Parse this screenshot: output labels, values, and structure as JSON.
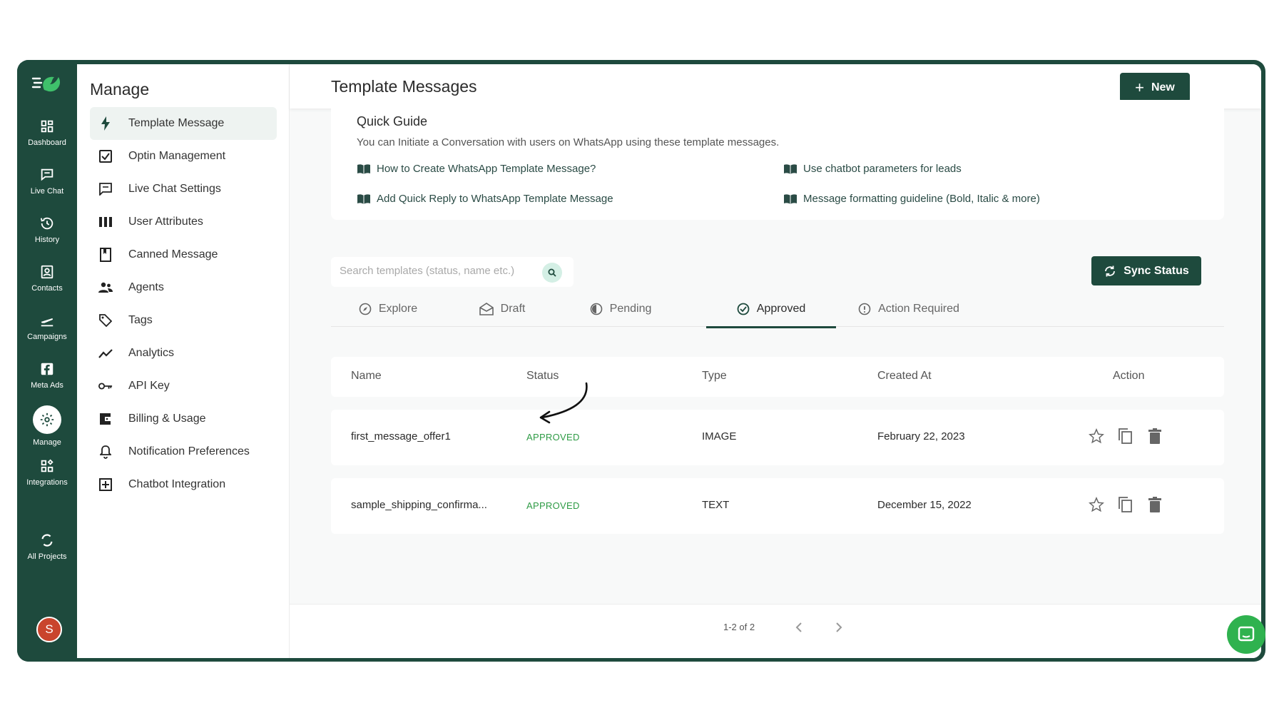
{
  "colors": {
    "brand_dark": "#1e4a3d",
    "approved_green": "#2e9b45",
    "chat_fab": "#2fb24f",
    "avatar": "#c9452d"
  },
  "rail": {
    "items": [
      {
        "label": "Dashboard",
        "icon": "grid-icon"
      },
      {
        "label": "Live Chat",
        "icon": "chat-icon"
      },
      {
        "label": "History",
        "icon": "history-icon"
      },
      {
        "label": "Contacts",
        "icon": "contacts-icon"
      },
      {
        "label": "Campaigns",
        "icon": "plane-icon"
      },
      {
        "label": "Meta Ads",
        "icon": "facebook-icon"
      },
      {
        "label": "Manage",
        "icon": "gear-icon",
        "active": true
      },
      {
        "label": "Integrations",
        "icon": "integrations-icon"
      },
      {
        "label": "All Projects",
        "icon": "refresh-icon"
      }
    ],
    "avatar_initial": "S"
  },
  "manage": {
    "title": "Manage",
    "items": [
      {
        "label": "Template Message",
        "icon": "bolt-icon",
        "active": true
      },
      {
        "label": "Optin Management",
        "icon": "checkbox-icon"
      },
      {
        "label": "Live Chat Settings",
        "icon": "message-square-icon"
      },
      {
        "label": "User Attributes",
        "icon": "columns-icon"
      },
      {
        "label": "Canned Message",
        "icon": "bookmark-icon"
      },
      {
        "label": "Agents",
        "icon": "people-icon"
      },
      {
        "label": "Tags",
        "icon": "tag-icon"
      },
      {
        "label": "Analytics",
        "icon": "trend-icon"
      },
      {
        "label": "API Key",
        "icon": "key-icon"
      },
      {
        "label": "Billing & Usage",
        "icon": "wallet-icon"
      },
      {
        "label": "Notification Preferences",
        "icon": "bell-icon"
      },
      {
        "label": "Chatbot Integration",
        "icon": "plus-square-icon"
      }
    ]
  },
  "header": {
    "title": "Template Messages",
    "new_label": "New"
  },
  "guide": {
    "title": "Quick Guide",
    "description": "You can Initiate a Conversation with users on WhatsApp using these template messages.",
    "links": [
      "How to Create WhatsApp Template Message?",
      "Use chatbot parameters for leads",
      "Add Quick Reply to WhatsApp Template Message",
      "Message formatting guideline (Bold, Italic & more)"
    ]
  },
  "search": {
    "placeholder": "Search templates (status, name etc.)"
  },
  "sync_label": "Sync Status",
  "tabs": [
    {
      "label": "Explore",
      "icon": "compass-icon"
    },
    {
      "label": "Draft",
      "icon": "envelope-open-icon"
    },
    {
      "label": "Pending",
      "icon": "half-circle-icon"
    },
    {
      "label": "Approved",
      "icon": "check-circle-icon",
      "active": true
    },
    {
      "label": "Action Required",
      "icon": "info-circle-icon"
    }
  ],
  "table": {
    "columns": [
      "Name",
      "Status",
      "Type",
      "Created At",
      "Action"
    ],
    "rows": [
      {
        "name": "first_message_offer1",
        "status": "APPROVED",
        "type": "IMAGE",
        "created_at": "February 22, 2023"
      },
      {
        "name": "sample_shipping_confirma...",
        "status": "APPROVED",
        "type": "TEXT",
        "created_at": "December 15, 2022"
      }
    ]
  },
  "pager": {
    "text": "1-2 of 2"
  }
}
